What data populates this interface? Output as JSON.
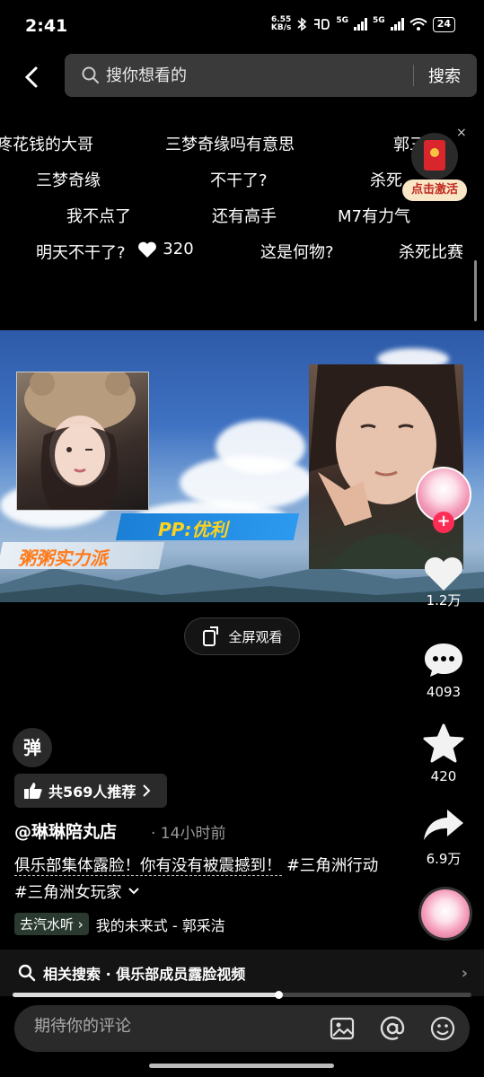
{
  "status_bar": {
    "time": "2:41",
    "net_speed_value": "6.55",
    "net_speed_unit": "KB/s",
    "network_1": "5G",
    "network_2": "5G",
    "battery": "24"
  },
  "search": {
    "placeholder": "搜你想看的",
    "button_label": "搜索"
  },
  "danmaku": [
    "疼花钱的大哥",
    "三梦奇缘吗有意思",
    "郭三",
    "三梦奇缘",
    "不干了?",
    "杀死",
    "我不点了",
    "还有高手",
    "M7有力气",
    "明天不干了?",
    "这是何物?",
    "杀死比赛"
  ],
  "danmaku_like_count": "320",
  "promo": {
    "label": "点击激活",
    "close": "×"
  },
  "video": {
    "pp_caption": "PP:优利",
    "team_caption": "粥粥实力派",
    "fullscreen_label": "全屏观看"
  },
  "side_actions": {
    "likes": "1.2万",
    "comments": "4093",
    "favorites": "420",
    "shares": "6.9万",
    "follow_plus": "+"
  },
  "info": {
    "danmaku_toggle": "弹",
    "recommend_label": "共569人推荐",
    "author": "@琳琳陪丸店",
    "time_ago": "· 14小时前",
    "description_text": "俱乐部集体露脸！你有没有被震撼到！",
    "hashtag_1": "#三角洲行动",
    "hashtag_2": "#三角洲女玩家",
    "listen_chip": "去汽水听",
    "music_title": "我的未来式 - 郭采洁"
  },
  "related_search": {
    "label": "相关搜索 · 俱乐部成员露脸视频"
  },
  "playback": {
    "progress_fraction": 0.58
  },
  "comment": {
    "placeholder": "期待你的评论"
  },
  "colors": {
    "accent_red": "#fe2c55",
    "promo_bg": "#f8e6c6",
    "pp_text": "#ffd21c",
    "team_text": "#ff7a1a"
  }
}
